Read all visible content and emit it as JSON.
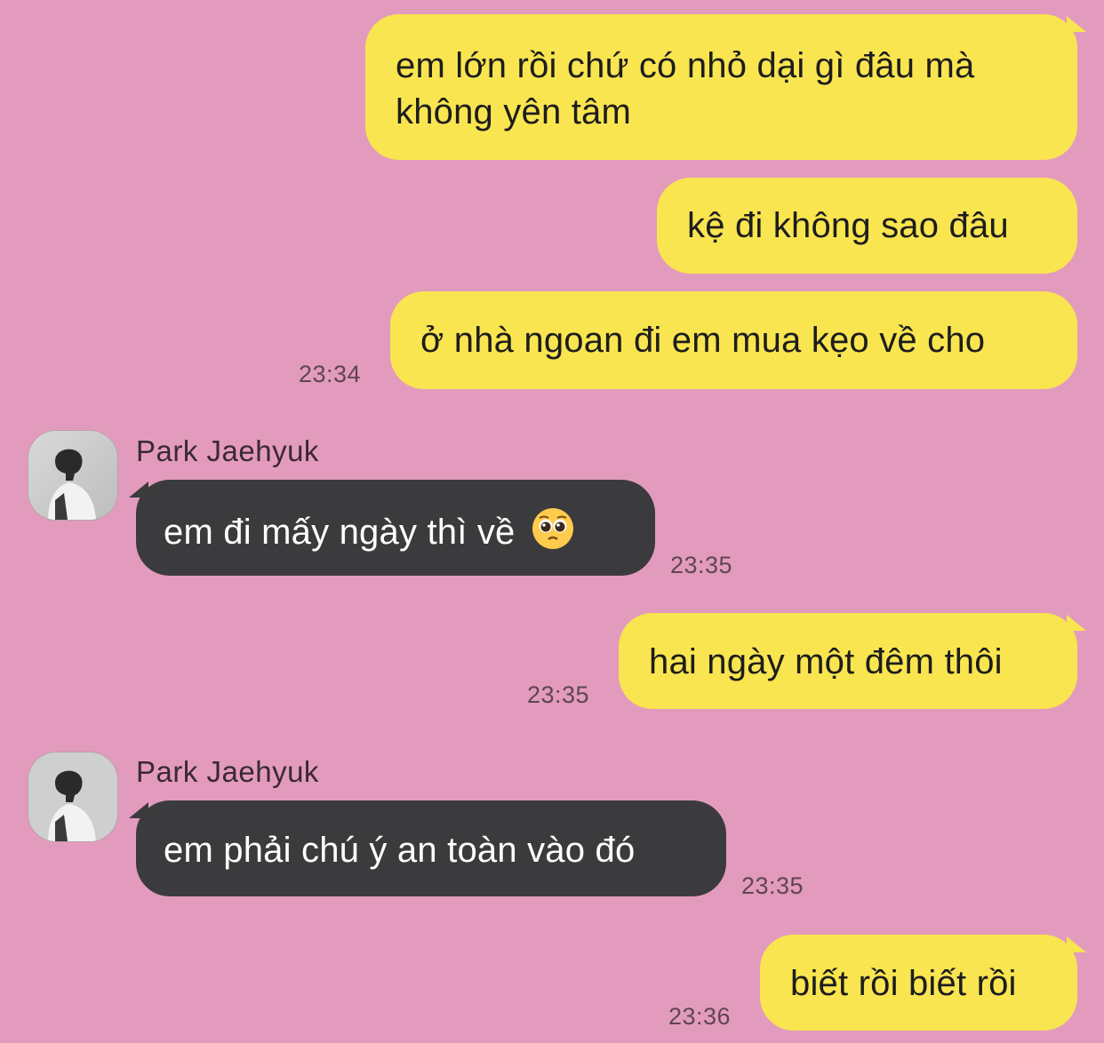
{
  "messages": {
    "m1": {
      "line1": "em lớn rồi chứ có nhỏ dại gì đâu mà",
      "line2": "không yên tâm"
    },
    "m2": {
      "text": "kệ đi không sao đâu"
    },
    "m3": {
      "text": "ở nhà ngoan đi em mua kẹo về cho",
      "time": "23:34"
    },
    "m4": {
      "sender": "Park Jaehyuk",
      "text": "em đi mấy ngày thì về",
      "emoji": "pleading-face",
      "time": "23:35"
    },
    "m5": {
      "text": "hai ngày một đêm thôi",
      "time": "23:35"
    },
    "m6": {
      "sender": "Park Jaehyuk",
      "text": "em phải chú ý an toàn vào đó",
      "time": "23:35"
    },
    "m7": {
      "text": "biết rồi biết rồi",
      "time": "23:36"
    }
  },
  "colors": {
    "background": "#e39bbd",
    "outgoing_bubble": "#f9e550",
    "incoming_bubble": "#3b3b3d"
  }
}
